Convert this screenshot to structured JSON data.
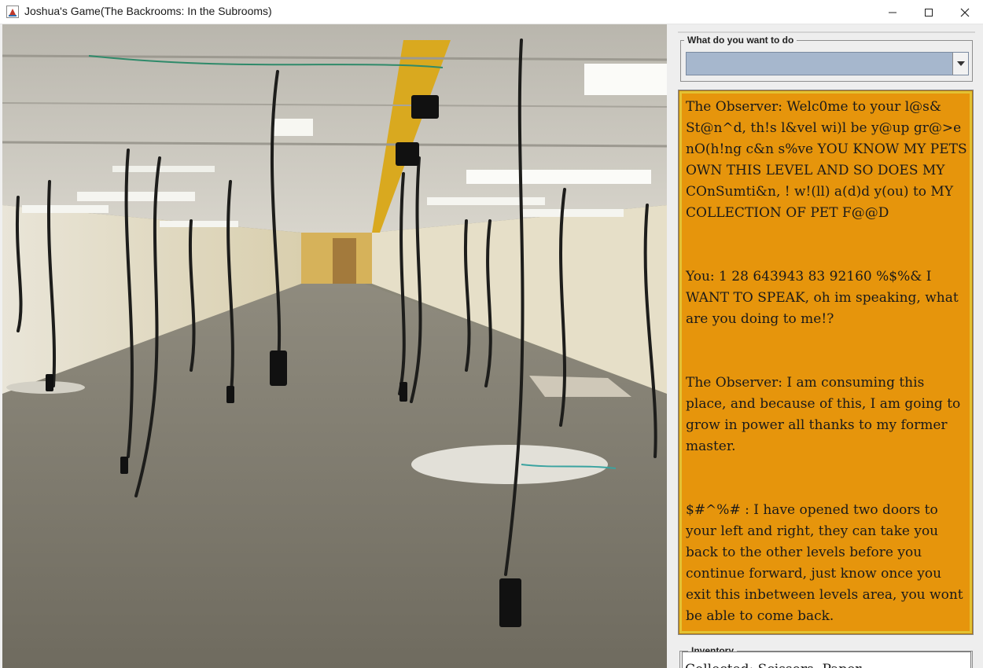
{
  "window": {
    "title": "Joshua's Game(The Backrooms: In the Subrooms)"
  },
  "scene": {
    "image": "office-hallway-with-hanging-cables"
  },
  "actions": {
    "legend": "What do you want to do",
    "selected": ""
  },
  "story": {
    "paragraphs": [
      "The Observer: Welc0me to your l@s& St@n^d, th!s l&vel wi)l be y@up gr@>e nO(h!ng c&n s%ve YOU KNOW MY PETS OWN THIS LEVEL AND SO DOES MY COnSumti&n, ! w!(ll) a(d)d y(ou) to MY COLLECTION OF PET F@@D",
      "You: 1 28 643943 83 92160 %$%& I WANT TO SPEAK, oh im speaking, what are you doing to me!?",
      "The Observer: I am consuming this place, and because of this, I am going to grow in power all thanks to my former master.",
      "$#^%# : I have opened two doors to your left and right, they can take you back to the other levels before you continue forward, just know once you exit this inbetween levels area, you wont be able to come back."
    ],
    "background": "#e6950c",
    "border": "#e3c233"
  },
  "inventory": {
    "legend": "Inventory",
    "text": "Collected: Scissors, Paper"
  },
  "colors": {
    "combo_fill": "#a6b7cd"
  }
}
